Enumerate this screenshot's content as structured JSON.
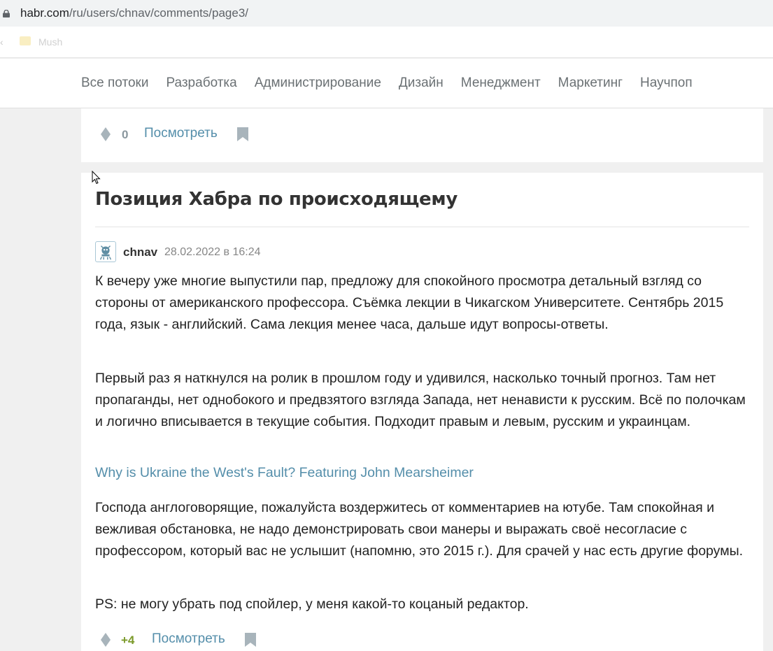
{
  "browser": {
    "url_host": "habr.com",
    "url_path": "/ru/users/chnav/comments/page3/",
    "bookmark_label": "Mush"
  },
  "nav": {
    "items": [
      "Все потоки",
      "Разработка",
      "Администрирование",
      "Дизайн",
      "Менеджмент",
      "Маркетинг",
      "Научпоп"
    ]
  },
  "top_comment": {
    "score": "0",
    "view_label": "Посмотреть"
  },
  "post": {
    "title": "Позиция Хабра по происходящему",
    "author": "chnav",
    "date": "28.02.2022 в 16:24",
    "paragraphs": [
      "К вечеру уже многие выпустили пар, предложу для спокойного просмотра детальный взгляд со стороны от американского профессора. Съёмка лекции в Чикагском Университете. Сентябрь 2015 года, язык - английский. Сама лекция менее часа, дальше идут вопросы-ответы.",
      "Первый раз я наткнулся на ролик в прошлом году и удивился, насколько точный прогноз. Там нет пропаганды, нет однобокого и предвзятого взгляда Запада, нет ненависти к русским. Всё по полочкам и логично вписывается в текущие события. Подходит правым и левым, русским и украинцам.",
      "Господа англоговорящие, пожалуйста воздержитесь от комментариев на ютубе. Там спокойная и вежливая обстановка, не надо демонстрировать свои манеры и выражать своё несогласие с профессором, который вас не услышит (напомню, это 2015 г.). Для срачей у нас есть другие форумы.",
      "PS: не могу убрать под спойлер, у меня какой-то коцаный редактор."
    ],
    "link_text": "Why is Ukraine the West's Fault? Featuring John Mearsheimer",
    "score": "+4",
    "view_label": "Посмотреть"
  },
  "colors": {
    "link": "#548eaa",
    "score_positive": "#7b9a2a",
    "score_neutral": "#8a979e",
    "icon_gray": "#a8b4bb"
  },
  "icons": {
    "lock": "lock-icon",
    "vote": "vote-diamond-icon",
    "bookmark": "bookmark-icon",
    "avatar": "robot-avatar-icon",
    "cursor": "mouse-cursor-icon"
  }
}
